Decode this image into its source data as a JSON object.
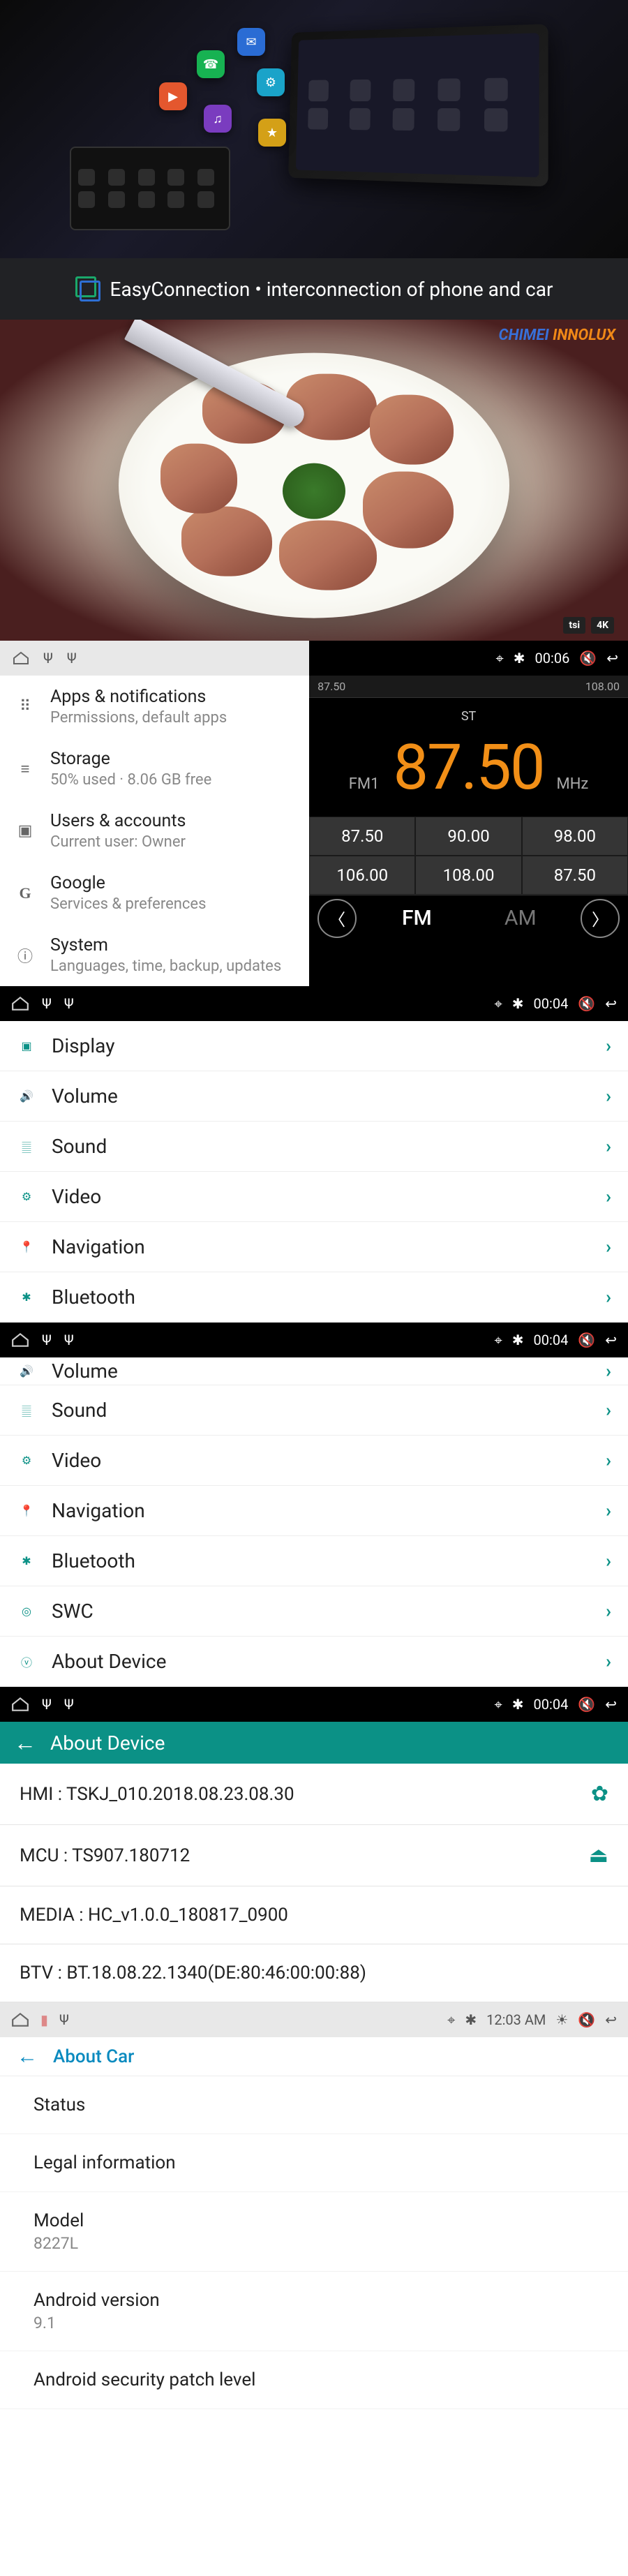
{
  "easyconn": {
    "label": "EasyConnection • interconnection of phone and car"
  },
  "video_wm": {
    "a": "CHIMEI",
    "b": "INNOLUX",
    "b1": "tsi",
    "b2": "4K"
  },
  "settings_left": {
    "items": [
      {
        "title": "Apps & notifications",
        "sub": "Permissions, default apps"
      },
      {
        "title": "Storage",
        "sub": "50% used · 8.06 GB free"
      },
      {
        "title": "Users & accounts",
        "sub": "Current user: Owner"
      },
      {
        "title": "Google",
        "sub": "Services & preferences"
      },
      {
        "title": "System",
        "sub": "Languages, time, backup, updates"
      }
    ]
  },
  "radio": {
    "time": "00:06",
    "scale_lo": "87.50",
    "scale_hi": "108.00",
    "st": "ST",
    "band_label": "FM1",
    "freq": "87.50",
    "unit": "MHz",
    "presets": [
      "87.50",
      "90.00",
      "98.00",
      "106.00",
      "108.00",
      "87.50"
    ],
    "fm": "FM",
    "am": "AM"
  },
  "bar": {
    "time": "00:04"
  },
  "menu1": [
    "Display",
    "Volume",
    "Sound",
    "Video",
    "Navigation",
    "Bluetooth"
  ],
  "menu2_first": "Volume",
  "menu2": [
    "Sound",
    "Video",
    "Navigation",
    "Bluetooth",
    "SWC",
    "About Device"
  ],
  "about": {
    "title": "About Device",
    "rows": [
      "HMI : TSKJ_010.2018.08.23.08.30",
      "MCU : TS907.180712",
      "MEDIA : HC_v1.0.0_180817_0900",
      "BTV : BT.18.08.22.1340(DE:80:46:00:00:88)"
    ]
  },
  "ltime": "12:03 AM",
  "aboutcar": {
    "title": "About Car",
    "rows": [
      {
        "t": "Status"
      },
      {
        "t": "Legal information"
      },
      {
        "t": "Model",
        "s": "8227L"
      },
      {
        "t": "Android version",
        "s": "9.1"
      },
      {
        "t": "Android security patch level"
      }
    ]
  }
}
